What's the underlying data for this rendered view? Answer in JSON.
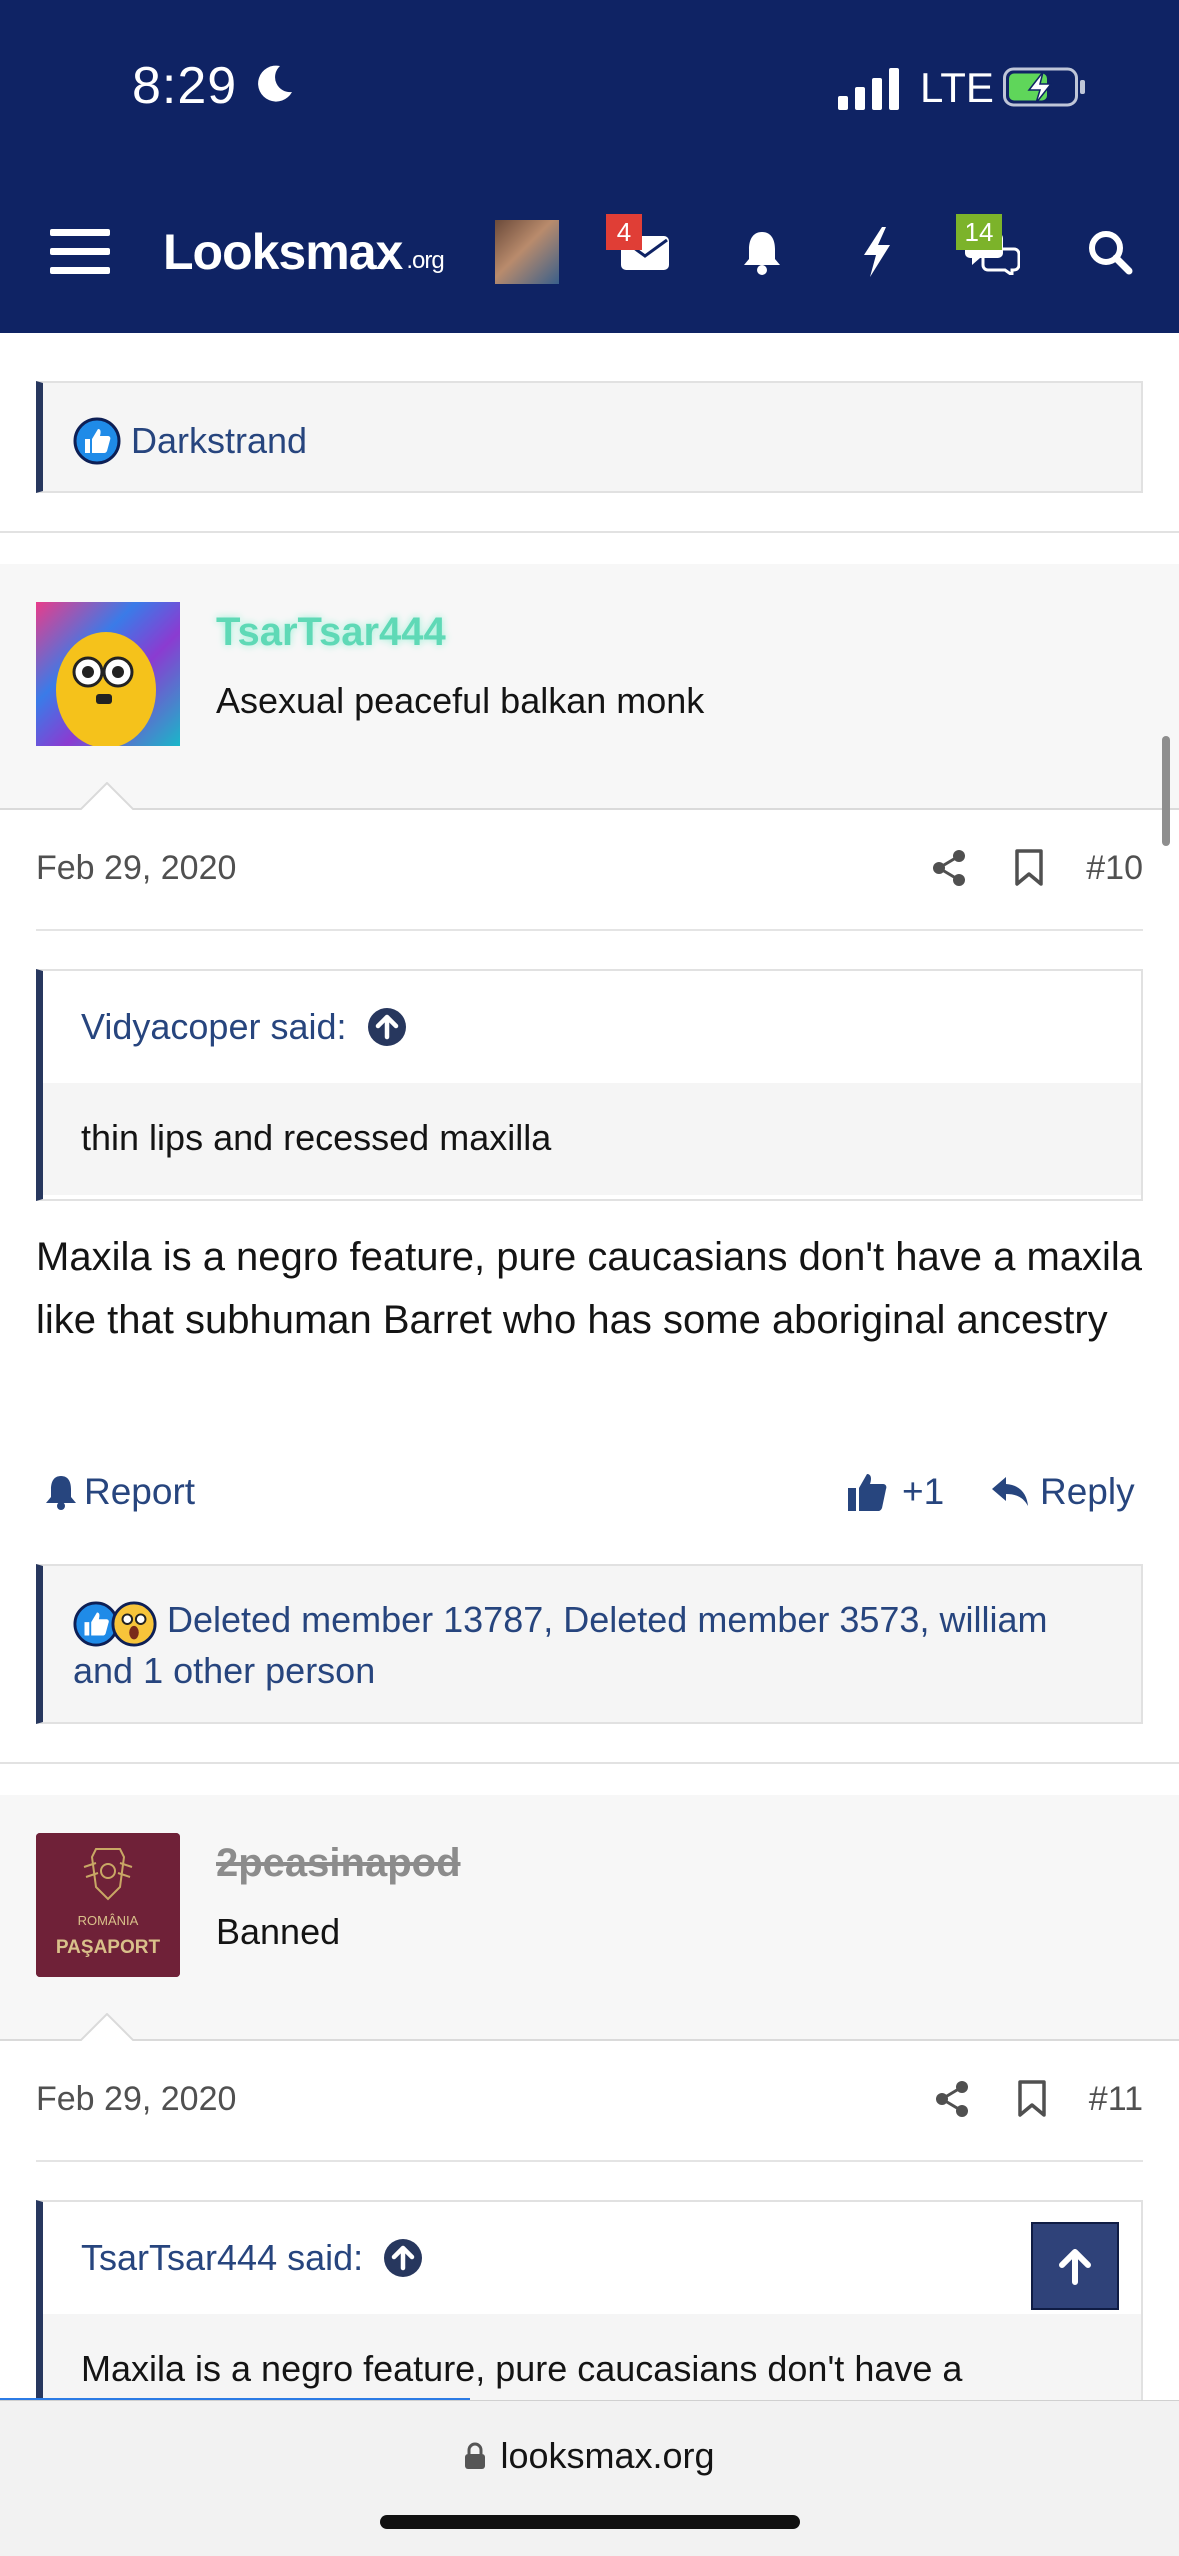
{
  "status_bar": {
    "time": "8:29",
    "network": "LTE"
  },
  "nav": {
    "logo_main": "Looksmax",
    "logo_suffix": ".org",
    "mail_badge": "4",
    "chats_badge": "14"
  },
  "prev_reactions": {
    "text": "Darkstrand"
  },
  "posts": [
    {
      "username": "TsarTsar444",
      "user_title": "Asexual peaceful balkan monk",
      "date": "Feb 29, 2020",
      "number": "#10",
      "quote_author": "Vidyacoper said:",
      "quote_text": "thin lips and recessed maxilla",
      "body": "Maxila is a negro feature, pure caucasians don't have a maxila like that subhuman Barret who has some aboriginal ancestry",
      "report_label": "Report",
      "like_label": "+1",
      "reply_label": "Reply",
      "reactions_line1": "Deleted member 13787, Deleted member 3573, william",
      "reactions_line2": "and 1 other person"
    },
    {
      "username": "2peasinapod",
      "user_title": "Banned",
      "avatar_text_top": "ROMÂNIA",
      "avatar_text_bottom": "PAŞAPORT",
      "date": "Feb 29, 2020",
      "number": "#11",
      "quote_author": "TsarTsar444 said:",
      "quote_text": "Maxila is a negro feature, pure caucasians don't have a"
    }
  ],
  "browser": {
    "url": "looksmax.org"
  },
  "colors": {
    "header": "#0f2364",
    "link": "#27457e",
    "quote_border": "#27375e",
    "username_green": "#5fd9b6",
    "banned_gray": "#8c8c8c"
  }
}
